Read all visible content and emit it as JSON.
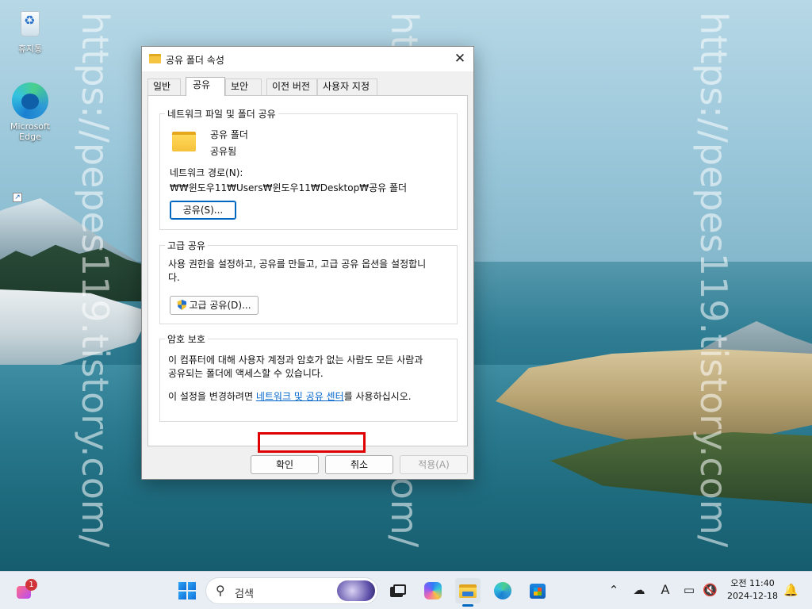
{
  "watermark": "https://pepes119.tistory.com/",
  "desktop": {
    "icons": [
      {
        "label": "휴지통",
        "icon": "recycle-bin-icon"
      },
      {
        "label": "Microsoft Edge",
        "icon": "edge-icon"
      }
    ]
  },
  "dialog": {
    "title": "공유 폴더 속성",
    "tabs": [
      {
        "label": "일반",
        "active": false
      },
      {
        "label": "공유",
        "active": true
      },
      {
        "label": "보안",
        "active": false
      },
      {
        "label": "이전 버전",
        "active": false
      },
      {
        "label": "사용자 지정",
        "active": false
      }
    ],
    "network_share": {
      "group_label": "네트워크 파일 및 폴더 공유",
      "folder_name": "공유 폴더",
      "share_status": "공유됨",
      "path_label": "네트워크 경로(N):",
      "path_value": "₩₩윈도우11₩Users₩윈도우11₩Desktop₩공유 폴더",
      "share_button": "공유(S)..."
    },
    "advanced_share": {
      "group_label": "고급 공유",
      "description_line1": "사용 권한을 설정하고, 공유를 만들고, 고급 공유 옵션을 설정합니",
      "description_line2": "다.",
      "button": "고급 공유(D)..."
    },
    "password_protection": {
      "group_label": "암호 보호",
      "description_line1": "이 컴퓨터에 대해 사용자 계정과 암호가 없는 사람도 모든 사람과",
      "description_line2": "공유되는 폴더에 액세스할 수 있습니다.",
      "change_prefix": "이 설정을 변경하려면",
      "link_text": "네트워크 및 공유 센터",
      "change_suffix": "를 사용하십시오."
    },
    "buttons": {
      "ok": "확인",
      "cancel": "취소",
      "apply": "적용(A)"
    },
    "highlight_color": "#e00000"
  },
  "taskbar": {
    "widgets_badge": "1",
    "search_placeholder": "검색",
    "ime_indicator": "A",
    "clock": {
      "time": "오전 11:40",
      "date": "2024-12-18"
    },
    "accent": "#0067c0"
  }
}
